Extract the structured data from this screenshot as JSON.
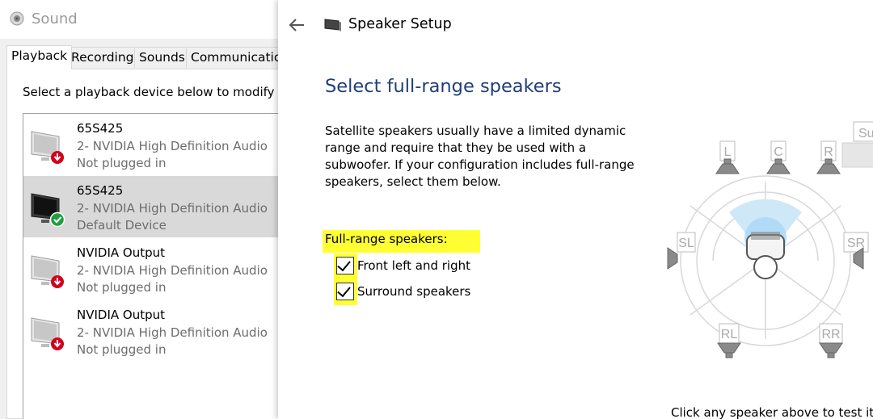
{
  "sound_window": {
    "title": "Sound",
    "tabs": [
      "Playback",
      "Recording",
      "Sounds",
      "Communications"
    ],
    "active_tab": "Playback",
    "instruction": "Select a playback device below to modify its se",
    "devices": [
      {
        "name": "65S425",
        "driver": "2- NVIDIA High Definition Audio",
        "status": "Not plugged in",
        "icon": "monitor-unplugged-icon"
      },
      {
        "name": "65S425",
        "driver": "2- NVIDIA High Definition Audio",
        "status": "Default Device",
        "icon": "monitor-default-icon",
        "selected": true
      },
      {
        "name": "NVIDIA Output",
        "driver": "2- NVIDIA High Definition Audio",
        "status": "Not plugged in",
        "icon": "monitor-unplugged-icon"
      },
      {
        "name": "NVIDIA Output",
        "driver": "2- NVIDIA High Definition Audio",
        "status": "Not plugged in",
        "icon": "monitor-unplugged-icon"
      }
    ]
  },
  "speaker_setup": {
    "window_title": "Speaker Setup",
    "heading": "Select full-range speakers",
    "description": "Satellite speakers usually have a limited dynamic range and require that they be used with a subwoofer. If your configuration includes full-range speakers, select them below.",
    "group_label": "Full-range speakers:",
    "options": [
      {
        "label": "Front left and right",
        "checked": true
      },
      {
        "label": "Surround speakers",
        "checked": true
      }
    ],
    "speakers": [
      "L",
      "C",
      "R",
      "Sub",
      "SL",
      "SR",
      "RL",
      "RR"
    ],
    "footer_hint": "Click any speaker above to test it."
  },
  "colors": {
    "heading": "#1f3f7a",
    "highlight": "#ffff33",
    "selected_row": "#d9d9d9",
    "default_badge": "#1e9e3e",
    "unplugged_badge": "#d0021b"
  }
}
